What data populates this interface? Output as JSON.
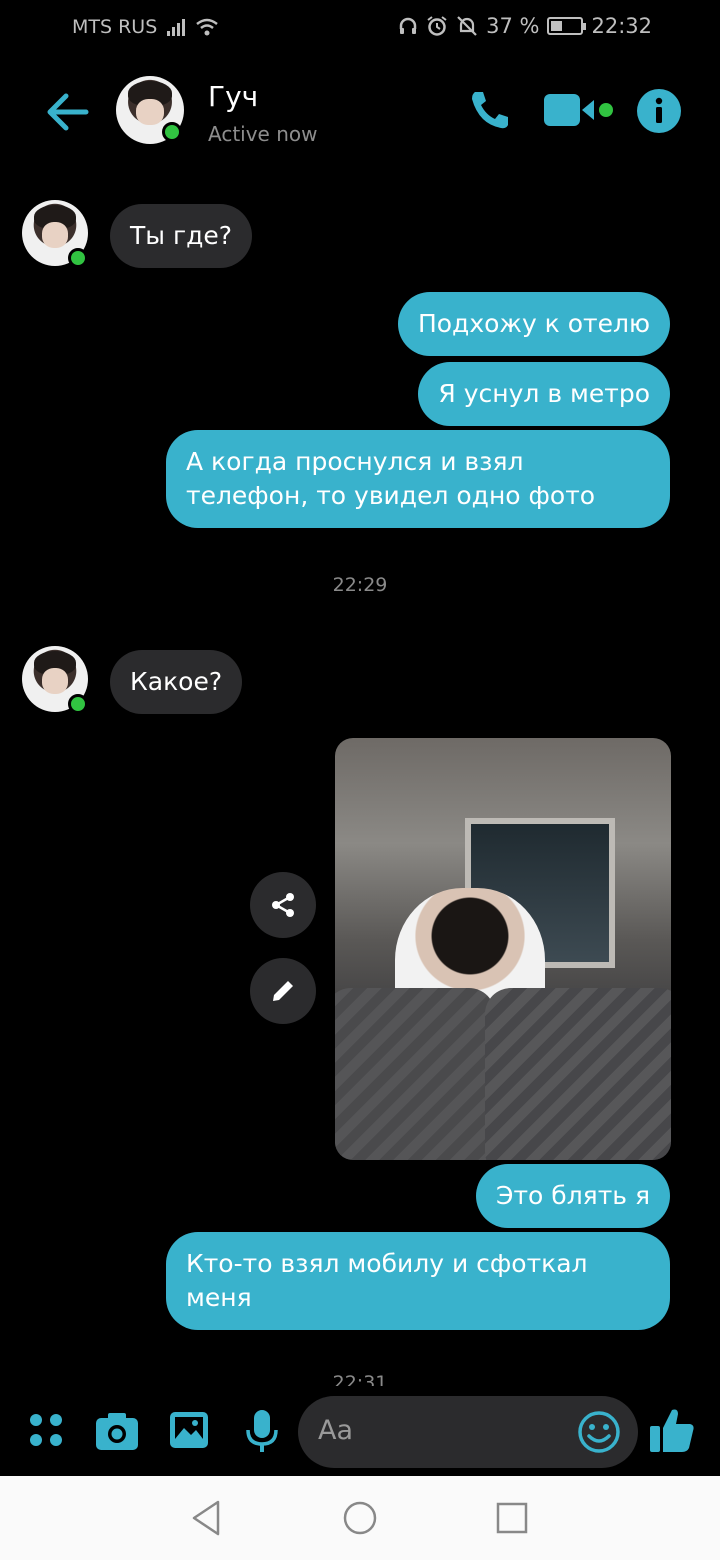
{
  "status_bar": {
    "carrier": "MTS RUS",
    "battery": "37 %",
    "battery_level": 0.37,
    "time": "22:32"
  },
  "header": {
    "title": "Гуч",
    "subtitle": "Active now"
  },
  "messages": {
    "m1": "Ты где?",
    "m2": "Подхожу к отелю",
    "m3": "Я уснул в метро",
    "m4": "А когда проснулся и взял телефон, то увидел одно фото",
    "time1": "22:29",
    "m5": "Какое?",
    "m6": "Это блять я",
    "m7": "Кто-то взял мобилу и сфоткал меня",
    "time2": "22:31"
  },
  "composer": {
    "placeholder": "Aa"
  },
  "colors": {
    "accent": "#39b2cc",
    "incoming_bubble": "#2b2b2d",
    "online": "#31c341"
  },
  "icons": [
    "back-arrow-icon",
    "phone-icon",
    "video-icon",
    "info-icon",
    "share-icon",
    "edit-icon",
    "apps-icon",
    "camera-icon",
    "gallery-icon",
    "mic-icon",
    "emoji-icon",
    "like-icon",
    "nav-back-icon",
    "nav-home-icon",
    "nav-recents-icon"
  ]
}
